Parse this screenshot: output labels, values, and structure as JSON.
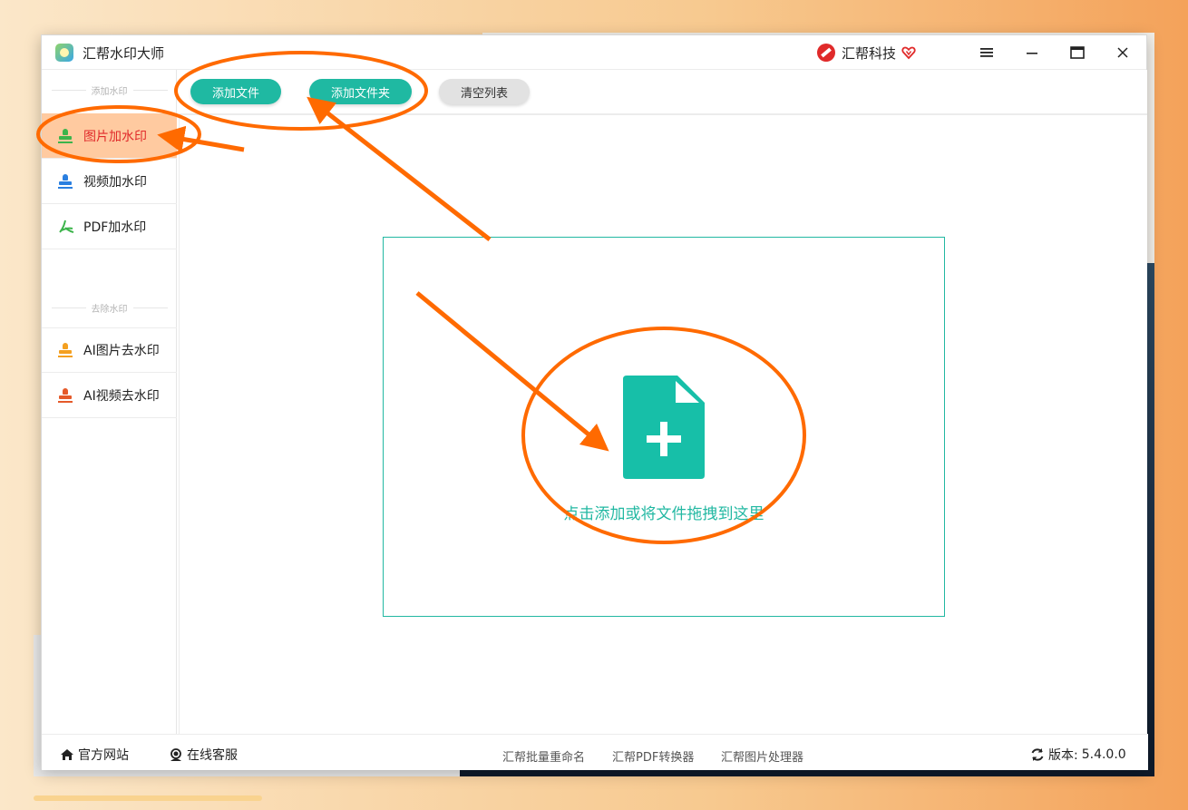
{
  "window": {
    "title": "汇帮水印大师",
    "brand": "汇帮科技"
  },
  "toolbar": {
    "add_file": "添加文件",
    "add_folder": "添加文件夹",
    "clear_list": "清空列表"
  },
  "sidebar": {
    "group_add": "添加水印",
    "group_remove": "去除水印",
    "items": [
      {
        "label": "图片加水印",
        "icon": "image-stamp-icon",
        "active": true
      },
      {
        "label": "视频加水印",
        "icon": "video-stamp-icon",
        "active": false
      },
      {
        "label": "PDF加水印",
        "icon": "pdf-icon",
        "active": false
      },
      {
        "label": "AI图片去水印",
        "icon": "ai-image-stamp-icon",
        "active": false
      },
      {
        "label": "AI视频去水印",
        "icon": "ai-video-stamp-icon",
        "active": false
      }
    ]
  },
  "dropzone": {
    "text": "点击添加或将文件拖拽到这里",
    "icon": "file-add-icon"
  },
  "statusbar": {
    "website": "官方网站",
    "support": "在线客服",
    "tools": [
      "汇帮批量重命名",
      "汇帮PDF转换器",
      "汇帮图片处理器"
    ],
    "version_label": "版本:",
    "version": "5.4.0.0"
  },
  "colors": {
    "accent": "#1fb9a2",
    "active_bg": "#ffcaa0",
    "active_text": "#e02a2a",
    "annotation": "#ff6a00"
  }
}
